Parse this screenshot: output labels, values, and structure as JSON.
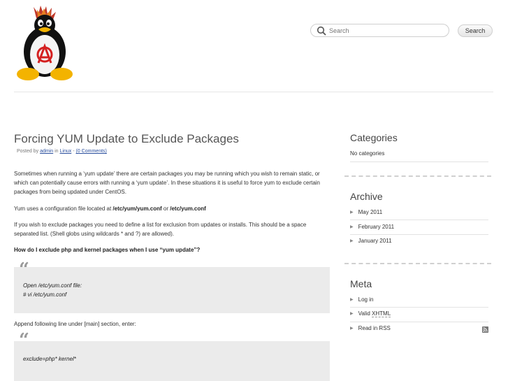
{
  "search": {
    "placeholder": "Search",
    "button_label": "Search"
  },
  "post": {
    "title": "Forcing YUM Update to Exclude Packages",
    "meta": {
      "prefix": "Posted by",
      "author": "admin",
      "in_word": "in",
      "category": "Linux",
      "separator": "-",
      "comments": "(0 Comments)"
    },
    "paragraphs": {
      "p1": "Sometimes when running a ‘yum update’ there are certain packages you may be running which you wish to remain static, or which can potentially cause errors with running a ‘yum update’. In these situations it is useful to force yum to exclude certain packages from being updated under CentOS.",
      "p2_a": "Yum uses a configuration file located at ",
      "p2_b": "/etc/yum/yum.conf",
      "p2_c": " or ",
      "p2_d": "/etc/yum.conf",
      "p3": "If you wish to exclude packages you need to define a list for exclusion from updates or installs. This should be a space separated list. (Shell globs using wildcards * and ?) are allowed).",
      "p4": "How do I exclude php and kernel packages when I use “yum update”?",
      "p5": "Append following line under [main] section, enter:"
    },
    "quote1": {
      "mark": "“",
      "line1": "Open /etc/yum.conf file:",
      "line2": "# vi /etc/yum.conf"
    },
    "quote2": {
      "mark": "“",
      "line1": "exclude=php* kernel*"
    }
  },
  "sidebar": {
    "categories": {
      "title": "Categories",
      "empty_text": "No categories"
    },
    "archive": {
      "title": "Archive",
      "items": [
        "May 2011",
        "February 2011",
        "January 2011"
      ]
    },
    "meta": {
      "title": "Meta",
      "login": "Log in",
      "valid_prefix": "Valid ",
      "valid_abbr": "XHTML",
      "rss": "Read in RSS"
    }
  },
  "colors": {
    "link": "#2a4f9e",
    "quote_bg": "#ebebeb",
    "title": "#555555",
    "anarchy_red": "#d42020"
  },
  "icons": {
    "search": "magnifier-icon",
    "rss": "rss-icon",
    "bullet": "triangle-right-icon",
    "logo": "tux-anarchy-logo"
  }
}
